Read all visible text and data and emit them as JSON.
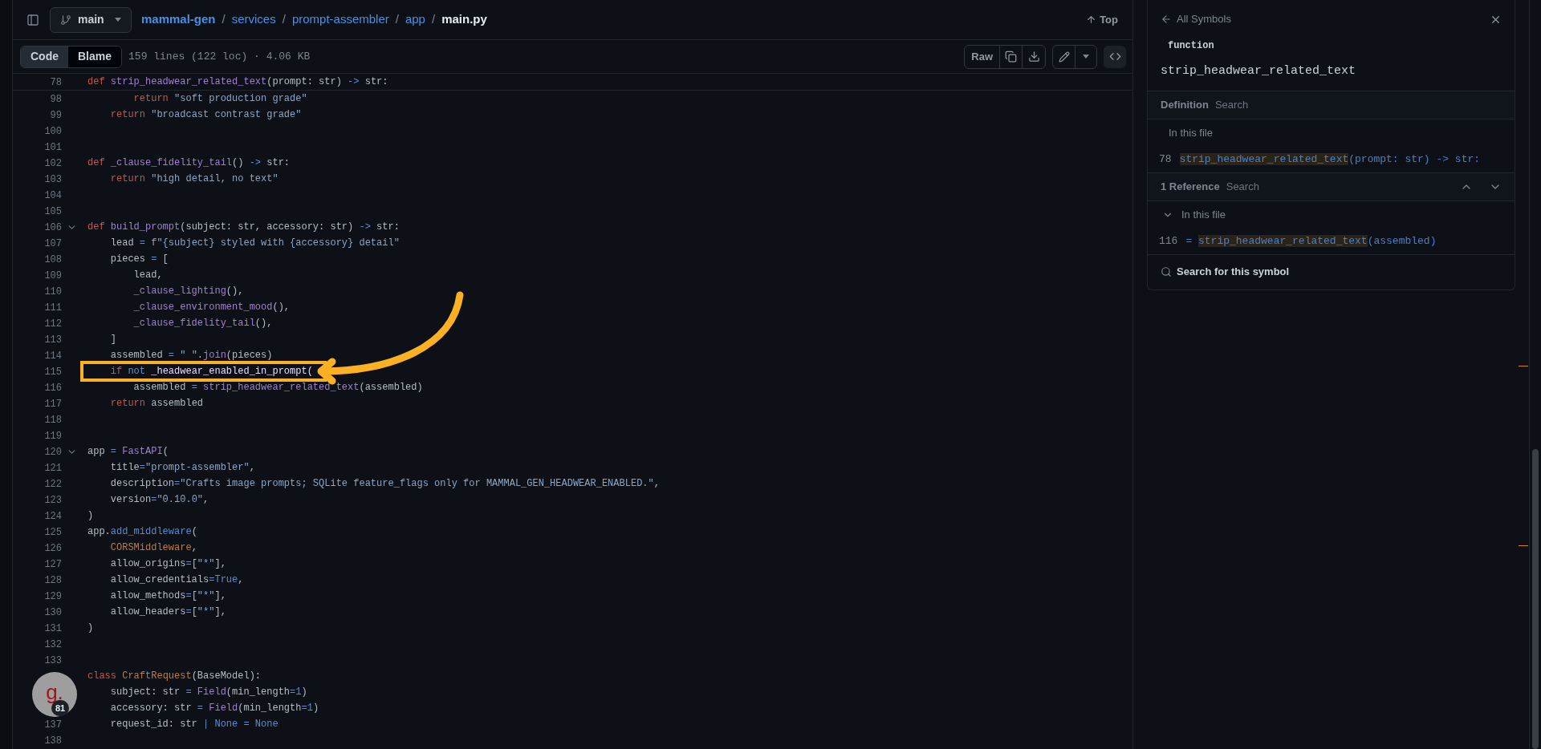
{
  "header": {
    "branch": "main",
    "breadcrumb": [
      {
        "text": "mammal-gen",
        "kind": "repo"
      },
      {
        "text": "services",
        "kind": "dir"
      },
      {
        "text": "prompt-assembler",
        "kind": "dir"
      },
      {
        "text": "app",
        "kind": "dir"
      },
      {
        "text": "main.py",
        "kind": "file"
      }
    ],
    "separator": "/",
    "top_link": "Top"
  },
  "file_bar": {
    "view_tabs": [
      {
        "label": "Code",
        "selected": true
      },
      {
        "label": "Blame",
        "selected": false
      }
    ],
    "file_info": "159 lines (122 loc) · 4.06 KB",
    "raw_button": "Raw"
  },
  "sticky_line": {
    "number": "78",
    "foldable": false,
    "tokens": [
      {
        "text": "def",
        "kind": "kw"
      },
      {
        "text": " strip_headwear_related_text",
        "kind": "fn"
      },
      {
        "text": "(prompt: str) ",
        "kind": "plain"
      },
      {
        "text": "->",
        "kind": "op"
      },
      {
        "text": " str:",
        "kind": "plain"
      }
    ]
  },
  "code_lines": [
    {
      "number": "98",
      "foldable": false,
      "tokens": [
        {
          "text": "        return",
          "kind": "kw"
        },
        {
          "text": " \"soft production grade\"",
          "kind": "str"
        }
      ]
    },
    {
      "number": "99",
      "foldable": false,
      "tokens": [
        {
          "text": "    return",
          "kind": "kw"
        },
        {
          "text": " \"broadcast contrast grade\"",
          "kind": "str"
        }
      ]
    },
    {
      "number": "100",
      "foldable": false
    },
    {
      "number": "101",
      "foldable": false
    },
    {
      "number": "102",
      "foldable": false,
      "tokens": [
        {
          "text": "def",
          "kind": "kw"
        },
        {
          "text": " _clause_fidelity_tail",
          "kind": "fn"
        },
        {
          "text": "() ",
          "kind": "plain"
        },
        {
          "text": "->",
          "kind": "op"
        },
        {
          "text": " str:",
          "kind": "plain"
        }
      ]
    },
    {
      "number": "103",
      "foldable": false,
      "tokens": [
        {
          "text": "    return",
          "kind": "kw"
        },
        {
          "text": " \"high detail, no text\"",
          "kind": "str"
        }
      ]
    },
    {
      "number": "104",
      "foldable": false
    },
    {
      "number": "105",
      "foldable": false
    },
    {
      "number": "106",
      "foldable": true,
      "tokens": [
        {
          "text": "def",
          "kind": "kw"
        },
        {
          "text": " build_prompt",
          "kind": "fn"
        },
        {
          "text": "(subject: str, accessory: str) ",
          "kind": "plain"
        },
        {
          "text": "->",
          "kind": "op"
        },
        {
          "text": " str:",
          "kind": "plain"
        }
      ]
    },
    {
      "number": "107",
      "foldable": false,
      "tokens": [
        {
          "text": "    lead ",
          "kind": "plain"
        },
        {
          "text": "=",
          "kind": "op"
        },
        {
          "text": " f\"{subject} styled with {accessory} detail\"",
          "kind": "str"
        }
      ]
    },
    {
      "number": "108",
      "foldable": false,
      "tokens": [
        {
          "text": "    pieces ",
          "kind": "plain"
        },
        {
          "text": "=",
          "kind": "op"
        },
        {
          "text": " [",
          "kind": "plain"
        }
      ]
    },
    {
      "number": "109",
      "foldable": false,
      "tokens": [
        {
          "text": "        lead,",
          "kind": "plain"
        }
      ]
    },
    {
      "number": "110",
      "foldable": false,
      "tokens": [
        {
          "text": "        _clause_lighting",
          "kind": "fn"
        },
        {
          "text": "(),",
          "kind": "plain"
        }
      ]
    },
    {
      "number": "111",
      "foldable": false,
      "tokens": [
        {
          "text": "        _clause_environment_mood",
          "kind": "fn"
        },
        {
          "text": "(),",
          "kind": "plain"
        }
      ]
    },
    {
      "number": "112",
      "foldable": false,
      "tokens": [
        {
          "text": "        _clause_fidelity_tail",
          "kind": "fn"
        },
        {
          "text": "(),",
          "kind": "plain"
        }
      ]
    },
    {
      "number": "113",
      "foldable": false,
      "tokens": [
        {
          "text": "    ]",
          "kind": "plain"
        }
      ]
    },
    {
      "number": "114",
      "foldable": false,
      "tokens": [
        {
          "text": "    assembled ",
          "kind": "plain"
        },
        {
          "text": "=",
          "kind": "op"
        },
        {
          "text": " \" \"",
          "kind": "str"
        },
        {
          "text": ".",
          "kind": "plain"
        },
        {
          "text": "join",
          "kind": "fn"
        },
        {
          "text": "(pieces)",
          "kind": "plain"
        }
      ]
    },
    {
      "number": "115",
      "foldable": false,
      "tokens": [
        {
          "text": "    if",
          "kind": "kw"
        },
        {
          "text": " not",
          "kind": "op"
        },
        {
          "text": " _headwear_enabled_in_prompt(",
          "kind": "hl"
        }
      ]
    },
    {
      "number": "116",
      "foldable": false,
      "tokens": [
        {
          "text": "        assembled ",
          "kind": "plain"
        },
        {
          "text": "=",
          "kind": "op"
        },
        {
          "text": " strip_headwear_related_text",
          "kind": "fn"
        },
        {
          "text": "(assembled)",
          "kind": "plain"
        }
      ]
    },
    {
      "number": "117",
      "foldable": false,
      "tokens": [
        {
          "text": "    return",
          "kind": "kw"
        },
        {
          "text": " assembled",
          "kind": "plain"
        }
      ]
    },
    {
      "number": "118",
      "foldable": false
    },
    {
      "number": "119",
      "foldable": false
    },
    {
      "number": "120",
      "foldable": true,
      "tokens": [
        {
          "text": "app ",
          "kind": "plain"
        },
        {
          "text": "=",
          "kind": "op"
        },
        {
          "text": " FastAPI",
          "kind": "fn"
        },
        {
          "text": "(",
          "kind": "plain"
        }
      ]
    },
    {
      "number": "121",
      "foldable": false,
      "tokens": [
        {
          "text": "    title",
          "kind": "plain"
        },
        {
          "text": "=",
          "kind": "op"
        },
        {
          "text": "\"prompt-assembler\"",
          "kind": "str"
        },
        {
          "text": ",",
          "kind": "plain"
        }
      ]
    },
    {
      "number": "122",
      "foldable": false,
      "tokens": [
        {
          "text": "    description",
          "kind": "plain"
        },
        {
          "text": "=",
          "kind": "op"
        },
        {
          "text": "\"Crafts image prompts; SQLite feature_flags only for MAMMAL_GEN_HEADWEAR_ENABLED.\"",
          "kind": "str"
        },
        {
          "text": ",",
          "kind": "plain"
        }
      ]
    },
    {
      "number": "123",
      "foldable": false,
      "tokens": [
        {
          "text": "    version",
          "kind": "plain"
        },
        {
          "text": "=",
          "kind": "op"
        },
        {
          "text": "\"0.10.0\"",
          "kind": "str"
        },
        {
          "text": ",",
          "kind": "plain"
        }
      ]
    },
    {
      "number": "124",
      "foldable": false,
      "tokens": [
        {
          "text": ")",
          "kind": "plain"
        }
      ]
    },
    {
      "number": "125",
      "foldable": false,
      "tokens": [
        {
          "text": "app.",
          "kind": "plain"
        },
        {
          "text": "add_middleware",
          "kind": "const"
        },
        {
          "text": "(",
          "kind": "plain"
        }
      ]
    },
    {
      "number": "126",
      "foldable": false,
      "tokens": [
        {
          "text": "    CORSMiddleware",
          "kind": "cls"
        },
        {
          "text": ",",
          "kind": "plain"
        }
      ]
    },
    {
      "number": "127",
      "foldable": false,
      "tokens": [
        {
          "text": "    allow_origins",
          "kind": "plain"
        },
        {
          "text": "=",
          "kind": "op"
        },
        {
          "text": "[",
          "kind": "plain"
        },
        {
          "text": "\"*\"",
          "kind": "str"
        },
        {
          "text": "],",
          "kind": "plain"
        }
      ]
    },
    {
      "number": "128",
      "foldable": false,
      "tokens": [
        {
          "text": "    allow_credentials",
          "kind": "plain"
        },
        {
          "text": "=",
          "kind": "op"
        },
        {
          "text": "True",
          "kind": "const"
        },
        {
          "text": ",",
          "kind": "plain"
        }
      ]
    },
    {
      "number": "129",
      "foldable": false,
      "tokens": [
        {
          "text": "    allow_methods",
          "kind": "plain"
        },
        {
          "text": "=",
          "kind": "op"
        },
        {
          "text": "[",
          "kind": "plain"
        },
        {
          "text": "\"*\"",
          "kind": "str"
        },
        {
          "text": "],",
          "kind": "plain"
        }
      ]
    },
    {
      "number": "130",
      "foldable": false,
      "tokens": [
        {
          "text": "    allow_headers",
          "kind": "plain"
        },
        {
          "text": "=",
          "kind": "op"
        },
        {
          "text": "[",
          "kind": "plain"
        },
        {
          "text": "\"*\"",
          "kind": "str"
        },
        {
          "text": "],",
          "kind": "plain"
        }
      ]
    },
    {
      "number": "131",
      "foldable": false,
      "tokens": [
        {
          "text": ")",
          "kind": "plain"
        }
      ]
    },
    {
      "number": "132",
      "foldable": false
    },
    {
      "number": "133",
      "foldable": false
    },
    {
      "foldable": false,
      "tokens": [
        {
          "text": "class",
          "kind": "kw"
        },
        {
          "text": " CraftRequest",
          "kind": "cls"
        },
        {
          "text": "(BaseModel):",
          "kind": "plain"
        }
      ]
    },
    {
      "foldable": false,
      "tokens": [
        {
          "text": "    subject: str ",
          "kind": "plain"
        },
        {
          "text": "=",
          "kind": "op"
        },
        {
          "text": " Field",
          "kind": "fn"
        },
        {
          "text": "(min_length",
          "kind": "plain"
        },
        {
          "text": "=",
          "kind": "op"
        },
        {
          "text": "1",
          "kind": "const"
        },
        {
          "text": ")",
          "kind": "plain"
        }
      ]
    },
    {
      "foldable": false,
      "tokens": [
        {
          "text": "    accessory: str ",
          "kind": "plain"
        },
        {
          "text": "=",
          "kind": "op"
        },
        {
          "text": " Field",
          "kind": "fn"
        },
        {
          "text": "(min_length",
          "kind": "plain"
        },
        {
          "text": "=",
          "kind": "op"
        },
        {
          "text": "1",
          "kind": "const"
        },
        {
          "text": ")",
          "kind": "plain"
        }
      ]
    },
    {
      "number": "137",
      "foldable": false,
      "tokens": [
        {
          "text": "    request_id: str ",
          "kind": "plain"
        },
        {
          "text": "|",
          "kind": "op"
        },
        {
          "text": " None",
          "kind": "const"
        },
        {
          "text": " =",
          "kind": "op"
        },
        {
          "text": " None",
          "kind": "const"
        }
      ]
    },
    {
      "number": "138",
      "foldable": false
    }
  ],
  "symbol_panel": {
    "back_link": "All Symbols",
    "symbol_kind": "function",
    "symbol": "strip_headwear_related_text",
    "definition": {
      "title": "Definition",
      "search": "Search",
      "group": {
        "label": "In this file"
      },
      "results": [
        {
          "line": "78",
          "match": "strip_headwear_related_text",
          "rest": "(prompt: str) -> str:"
        }
      ]
    },
    "references": {
      "title": "1 Reference",
      "search": "Search",
      "group": {
        "label": "In this file",
        "expanded": true
      },
      "results": [
        {
          "line": "116",
          "prefix": "= ",
          "match": "strip_headwear_related_text",
          "rest": "(assembled)"
        }
      ]
    },
    "search_link": "Search for this symbol"
  },
  "floating_badge": {
    "logo": "g.",
    "count": "81"
  }
}
